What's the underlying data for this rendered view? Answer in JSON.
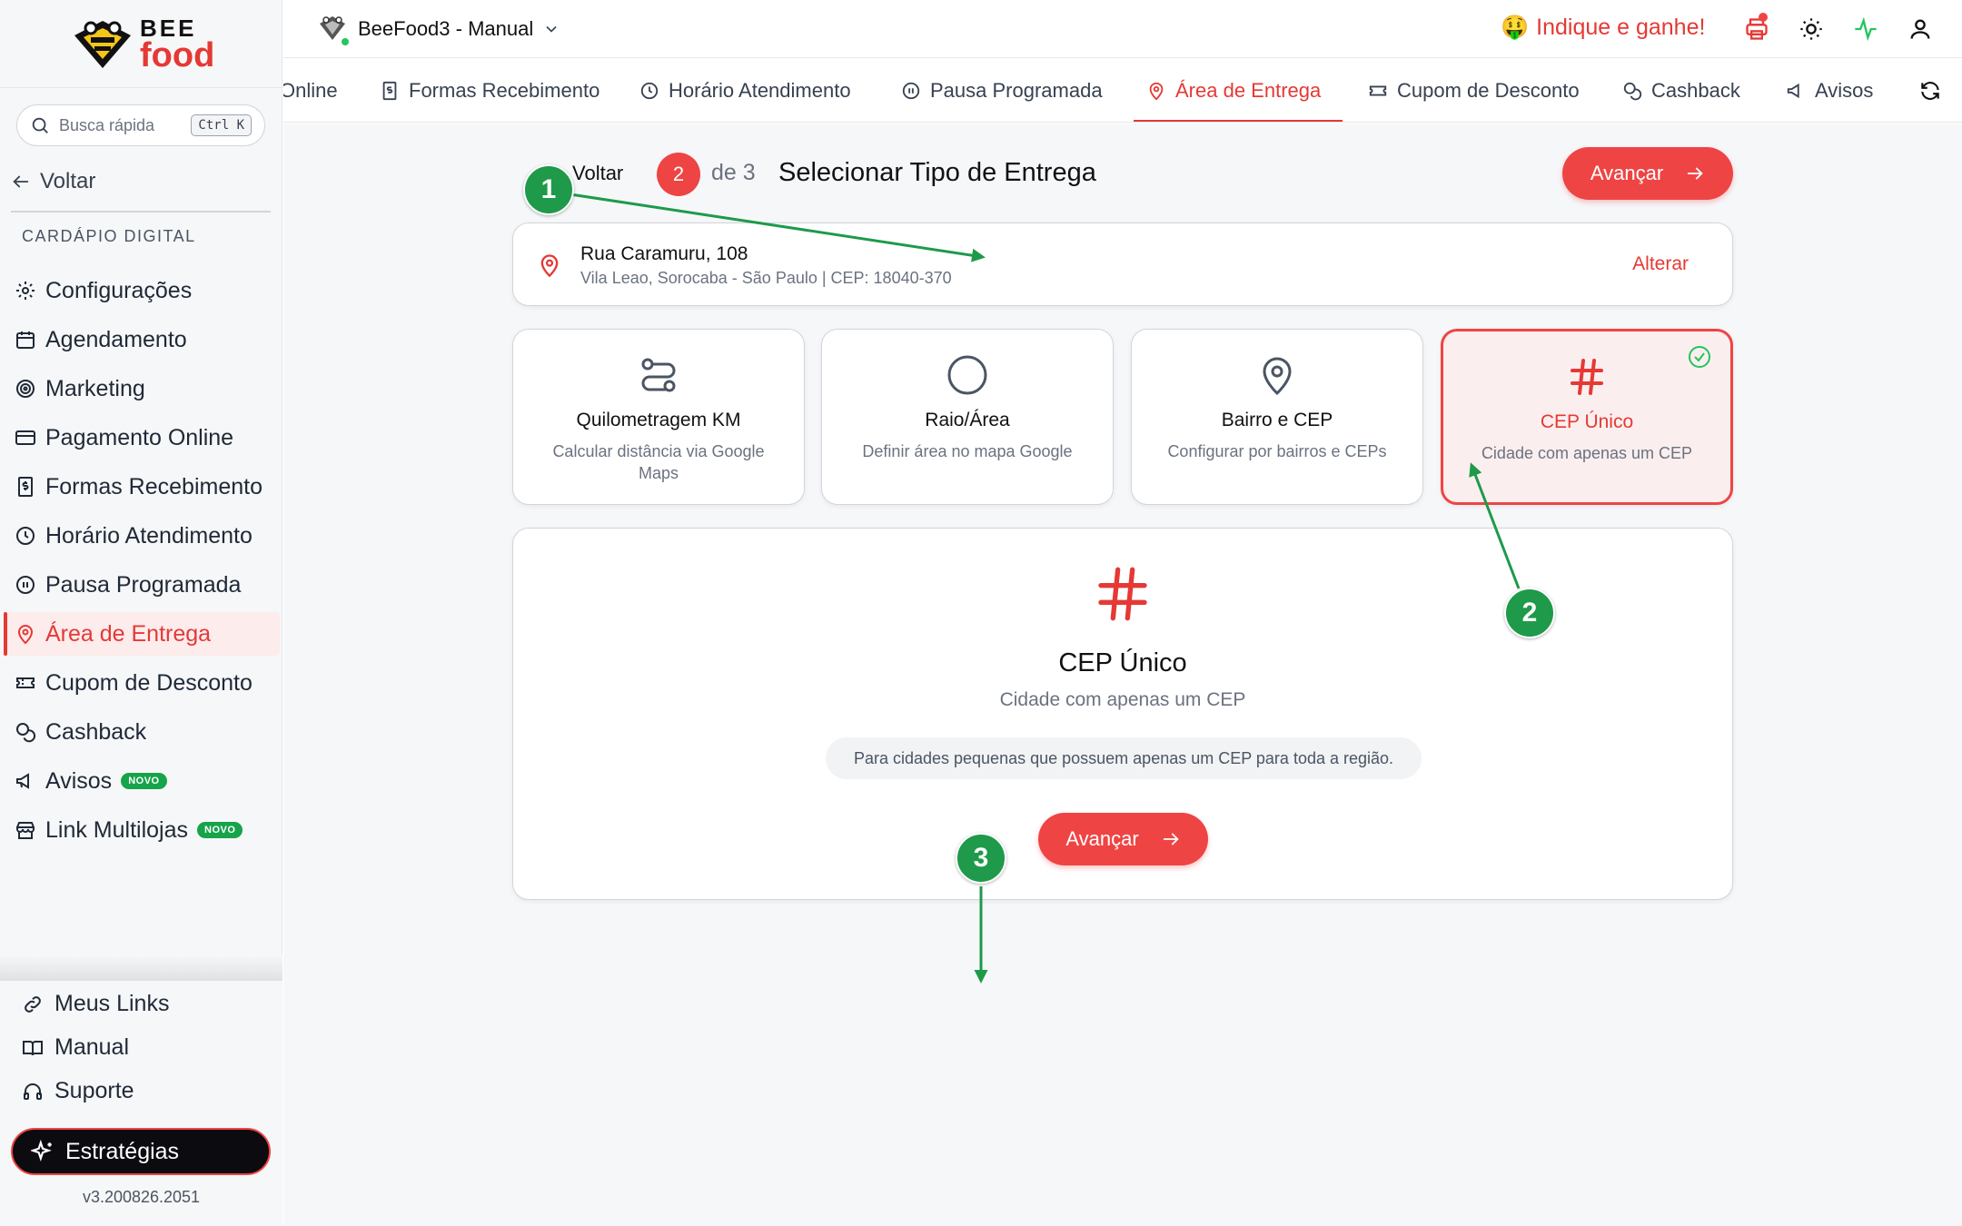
{
  "brand": {
    "line1": "BEE",
    "line2": "food"
  },
  "search": {
    "placeholder": "Busca rápida",
    "shortcut": "Ctrl K"
  },
  "sidebar": {
    "back_label": "Voltar",
    "section_label": "CARDÁPIO DIGITAL",
    "items": [
      {
        "label": "Configurações",
        "icon": "gear-icon"
      },
      {
        "label": "Agendamento",
        "icon": "calendar-icon"
      },
      {
        "label": "Marketing",
        "icon": "target-icon"
      },
      {
        "label": "Pagamento Online",
        "icon": "credit-card-icon"
      },
      {
        "label": "Formas Recebimento",
        "icon": "receipt-icon"
      },
      {
        "label": "Horário Atendimento",
        "icon": "clock-icon"
      },
      {
        "label": "Pausa Programada",
        "icon": "pause-icon"
      },
      {
        "label": "Área de Entrega",
        "icon": "map-pin-icon",
        "active": true
      },
      {
        "label": "Cupom de Desconto",
        "icon": "ticket-icon"
      },
      {
        "label": "Cashback",
        "icon": "coins-icon"
      },
      {
        "label": "Avisos",
        "icon": "megaphone-icon",
        "badge": "NOVO"
      },
      {
        "label": "Link Multilojas",
        "icon": "store-icon",
        "badge": "NOVO"
      }
    ],
    "bottom": {
      "links": "Meus Links",
      "manual": "Manual",
      "support": "Suporte"
    },
    "strategy_label": "Estratégias",
    "version": "v3.200826.2051"
  },
  "topbar": {
    "store_name": "BeeFood3 - Manual",
    "referral_label": "Indique e ganhe!",
    "referral_emoji": "🤑"
  },
  "tabs": [
    {
      "label": "Online"
    },
    {
      "label": "Formas Recebimento"
    },
    {
      "label": "Horário Atendimento"
    },
    {
      "label": "Pausa Programada"
    },
    {
      "label": "Área de Entrega",
      "active": true
    },
    {
      "label": "Cupom de Desconto"
    },
    {
      "label": "Cashback"
    },
    {
      "label": "Avisos"
    }
  ],
  "wizard": {
    "back_label": "Voltar",
    "step_current": "2",
    "step_total_label": "de 3",
    "title": "Selecionar Tipo de Entrega",
    "next_label": "Avançar"
  },
  "address": {
    "street": "Rua Caramuru, 108",
    "detail": "Vila Leao, Sorocaba - São Paulo | CEP: 18040-370",
    "change_label": "Alterar"
  },
  "options": [
    {
      "title": "Quilometragem KM",
      "desc": "Calcular distância via Google Maps",
      "icon": "route-icon"
    },
    {
      "title": "Raio/Área",
      "desc": "Definir área no mapa Google",
      "icon": "circle-icon"
    },
    {
      "title": "Bairro e CEP",
      "desc": "Configurar por bairros e CEPs",
      "icon": "map-pin-icon"
    },
    {
      "title": "CEP Único",
      "desc": "Cidade com apenas um CEP",
      "icon": "hash-icon",
      "selected": true
    }
  ],
  "detail": {
    "title": "CEP Único",
    "subtitle": "Cidade com apenas um CEP",
    "note": "Para cidades pequenas que possuem apenas um CEP para toda a região.",
    "next_label": "Avançar"
  },
  "annotations": [
    "1",
    "2",
    "3"
  ],
  "colors": {
    "accent": "#ef4444",
    "annotation": "#1e9a4a",
    "active_bg": "#fdecec"
  }
}
